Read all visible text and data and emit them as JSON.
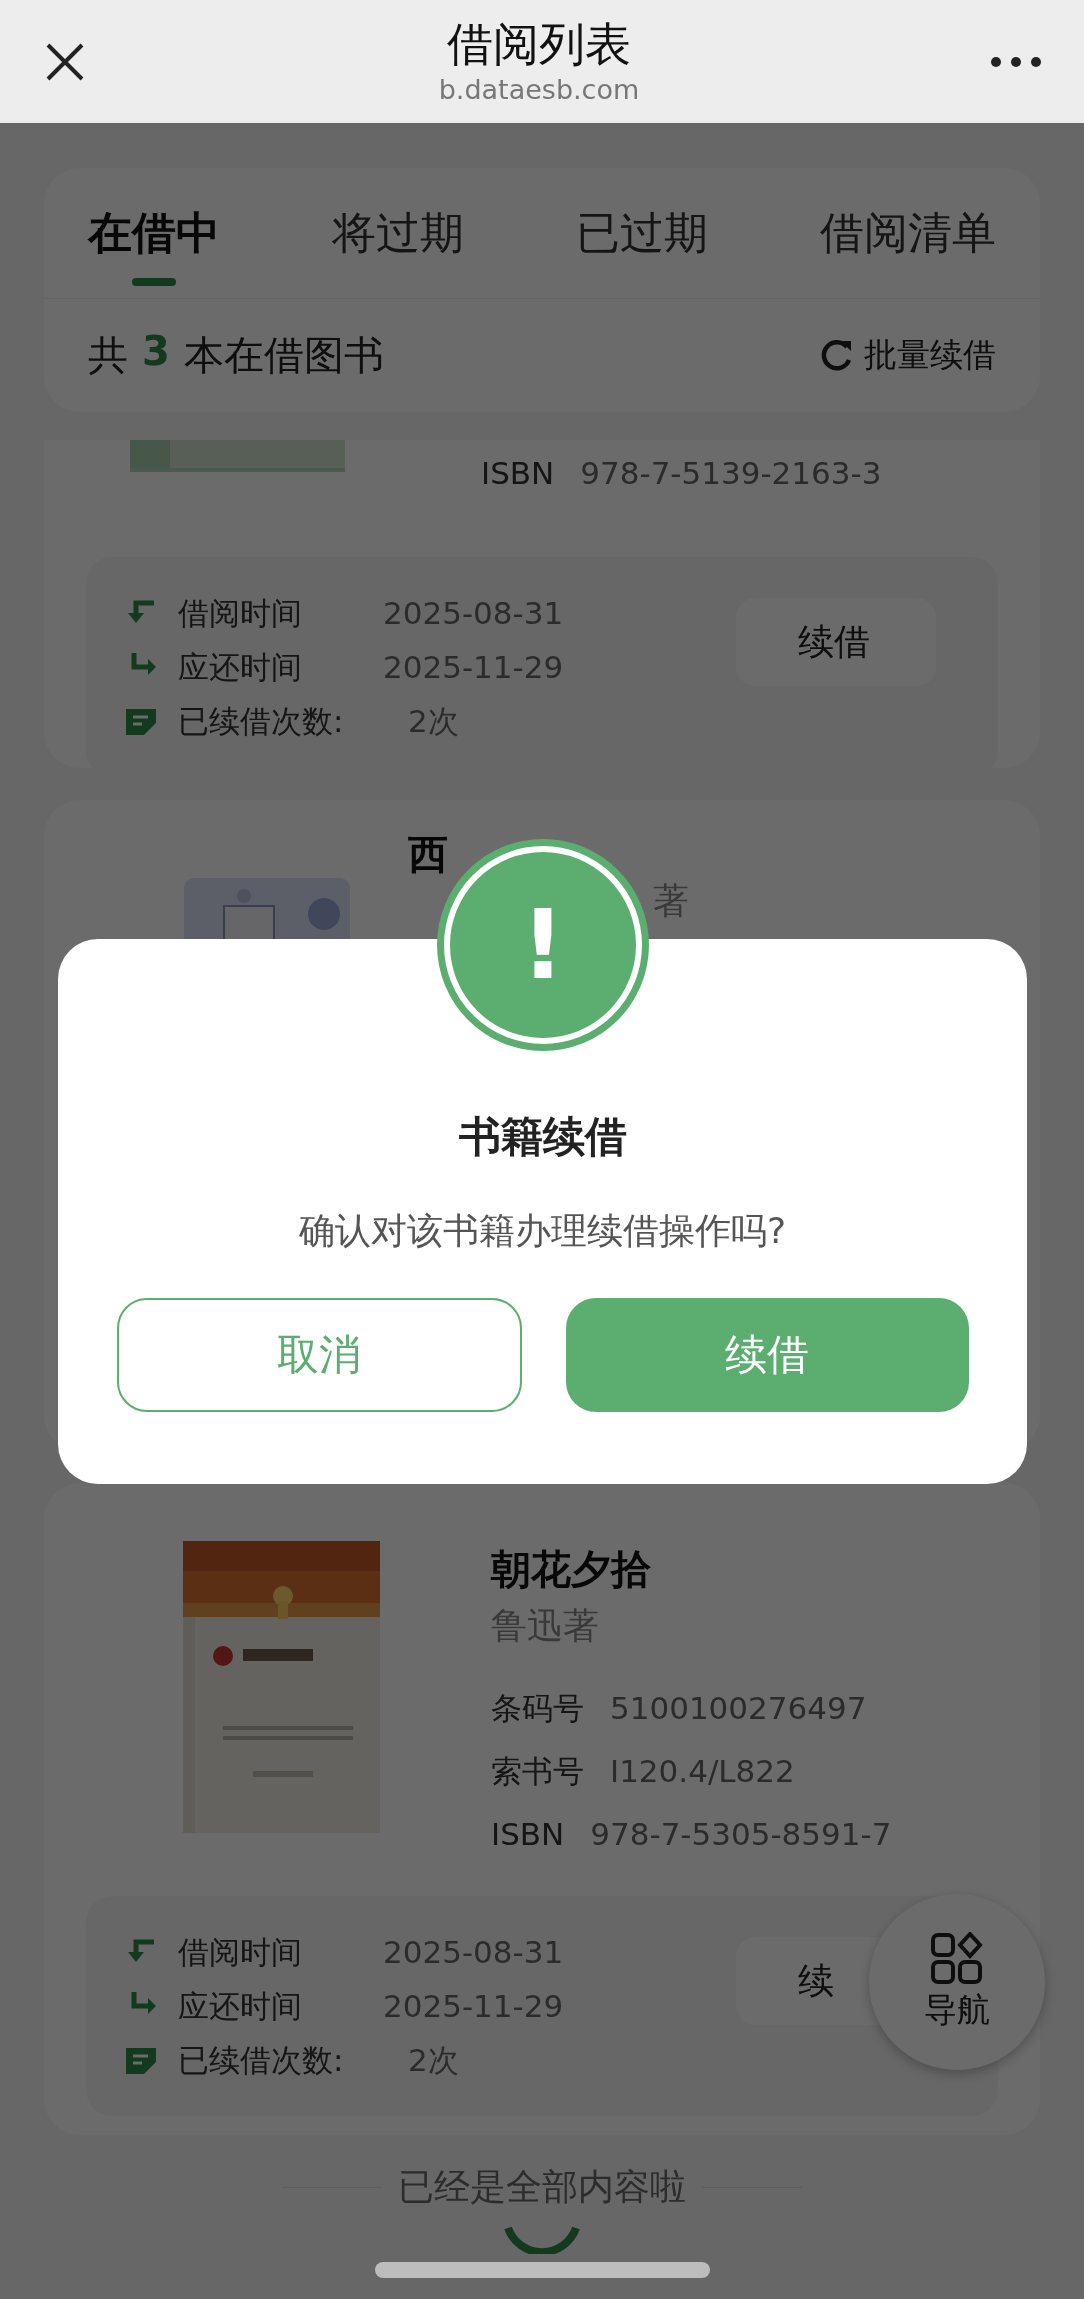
{
  "header": {
    "title": "借阅列表",
    "subtitle": "b.dataesb.com"
  },
  "tabs": [
    {
      "label": "在借中",
      "selected": true
    },
    {
      "label": "将过期",
      "selected": false
    },
    {
      "label": "已过期",
      "selected": false
    },
    {
      "label": "借阅清单",
      "selected": false
    }
  ],
  "summary": {
    "prefix": "共",
    "count": "3",
    "suffix": "本在借图书",
    "action": "批量续借"
  },
  "books": [
    {
      "kind": "cut",
      "fields": [
        {
          "label": "ISBN",
          "value": "978-7-5139-2163-3"
        }
      ],
      "loan": [
        {
          "kind": "borrow",
          "label": "借阅时间",
          "value": "2025-08-31"
        },
        {
          "kind": "due",
          "label": "应还时间",
          "value": "2025-11-29"
        },
        {
          "kind": "renewals",
          "label": "已续借次数:",
          "value": "2次"
        }
      ],
      "renew_button": "续借"
    },
    {
      "kind": "covered",
      "title": "西",
      "author": "著"
    },
    {
      "kind": "full",
      "title": "朝花夕拾",
      "author": "鲁迅著",
      "fields": [
        {
          "label": "条码号",
          "value": "5100100276497"
        },
        {
          "label": "索书号",
          "value": "I120.4/L822"
        },
        {
          "label": "ISBN",
          "value": "978-7-5305-8591-7"
        }
      ],
      "loan": [
        {
          "kind": "borrow",
          "label": "借阅时间",
          "value": "2025-08-31"
        },
        {
          "kind": "due",
          "label": "应还时间",
          "value": "2025-11-29"
        },
        {
          "kind": "renewals",
          "label": "已续借次数:",
          "value": "2次"
        }
      ],
      "renew_button": "续"
    }
  ],
  "footer": "已经是全部内容啦",
  "nav_button": {
    "label": "导航"
  },
  "modal": {
    "icon_text": "!",
    "title": "书籍续借",
    "message": "确认对该书籍办理续借操作吗?",
    "buttons": [
      {
        "kind": "cancel",
        "label": "取消"
      },
      {
        "kind": "confirm",
        "label": "续借"
      }
    ]
  }
}
